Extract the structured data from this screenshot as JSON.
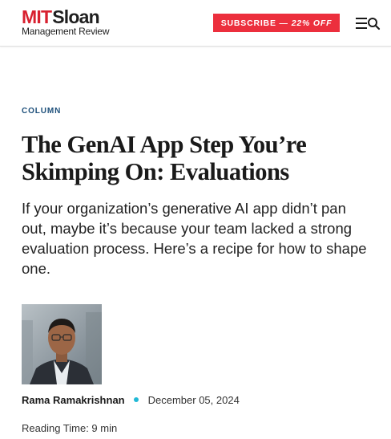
{
  "header": {
    "logo_mit": "MIT",
    "logo_sloan": "Sloan",
    "logo_sub": "Management Review",
    "subscribe_label": "SUBSCRIBE —",
    "subscribe_offer": "22% OFF",
    "menu_icon": "hamburger-menu-icon",
    "search_icon": "search-icon"
  },
  "article": {
    "section": "COLUMN",
    "title": "The GenAI App Step You’re Skimping On: Evaluations",
    "dek": "If your organization’s generative AI app didn’t pan out, maybe it’s because your team lacked a strong evaluation process. Here’s a recipe for how to shape one.",
    "author": "Rama Ramakrishnan",
    "date": "December 05, 2024",
    "reading_time": "Reading Time: 9 min"
  },
  "colors": {
    "brand_red": "#d8202f",
    "subscribe_bg": "#ec2f3d",
    "section_blue": "#1d4f7a",
    "dot_cyan": "#21b9d6"
  }
}
